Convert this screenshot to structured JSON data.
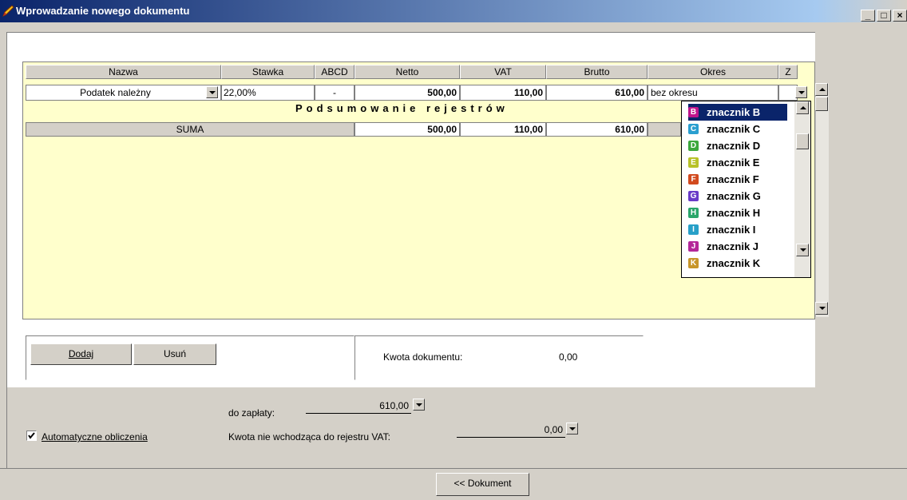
{
  "window": {
    "title": "Wprowadzanie nowego dokumentu"
  },
  "columns": [
    "Nazwa",
    "Stawka",
    "ABCD",
    "Netto",
    "VAT",
    "Brutto",
    "Okres",
    "Z"
  ],
  "row": {
    "nazwa": "Podatek należny",
    "stawka": "22,00%",
    "abcd": "-",
    "netto": "500,00",
    "vat": "110,00",
    "brutto": "610,00",
    "okres": "bez okresu"
  },
  "summary": {
    "heading": "Podsumowanie rejestrów",
    "label": "SUMA",
    "netto": "500,00",
    "vat": "110,00",
    "brutto": "610,00"
  },
  "markers": [
    {
      "letter": "B",
      "label": "znacznik B",
      "color": "#c0148c",
      "selected": true
    },
    {
      "letter": "C",
      "label": "znacznik C",
      "color": "#2a9fd0"
    },
    {
      "letter": "D",
      "label": "znacznik D",
      "color": "#3ca83c"
    },
    {
      "letter": "E",
      "label": "znacznik E",
      "color": "#b8c228"
    },
    {
      "letter": "F",
      "label": "znacznik F",
      "color": "#d24a1e"
    },
    {
      "letter": "G",
      "label": "znacznik G",
      "color": "#6a3cc8"
    },
    {
      "letter": "H",
      "label": "znacznik H",
      "color": "#2aa66a"
    },
    {
      "letter": "I",
      "label": "znacznik I",
      "color": "#28a0c8"
    },
    {
      "letter": "J",
      "label": "znacznik J",
      "color": "#b42898"
    },
    {
      "letter": "K",
      "label": "znacznik K",
      "color": "#c8962a"
    }
  ],
  "buttons": {
    "add": "Dodaj",
    "remove": "Usuń",
    "back": "<< Dokument"
  },
  "kwota": {
    "label": "Kwota dokumentu:",
    "value": "0,00"
  },
  "payment": {
    "label": "do zapłaty:",
    "value": "610,00"
  },
  "nonvat": {
    "label": "Kwota nie wchodząca do rejestru VAT:",
    "value": "0,00"
  },
  "auto": {
    "label": "Automatyczne obliczenia",
    "checked": true
  }
}
